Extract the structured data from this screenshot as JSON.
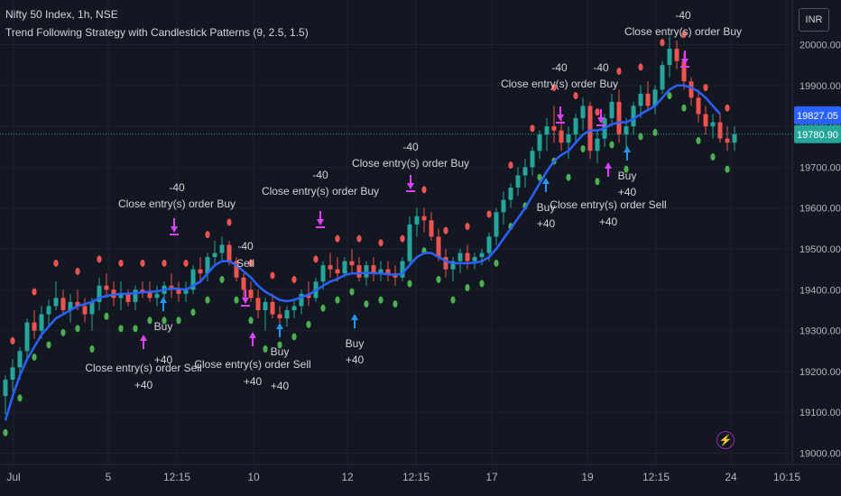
{
  "header": {
    "symbol": "Nifty 50 Index, 1h, NSE",
    "study": "Trend Following Strategy with Candlestick Patterns (9, 2.5, 1.5)"
  },
  "currency_button": "INR",
  "colors": {
    "background": "#131722",
    "up": "#26a69a",
    "down": "#ef5350",
    "ema": "#2962ff",
    "signal": "#e040fb",
    "stop_dot": "#4caf50",
    "dot_red": "#ef5350",
    "arrow": "#2196f3"
  },
  "chart_data": {
    "type": "candlestick",
    "title": "",
    "ylim": [
      19000,
      20050
    ],
    "y_ticks": [
      "20000.00",
      "19900.00",
      "19800.00",
      "19700.00",
      "19600.00",
      "19500.00",
      "19400.00",
      "19300.00",
      "19200.00",
      "19100.00",
      "19000.00"
    ],
    "x_ticks": [
      "Jul",
      "5",
      "12:15",
      "10",
      "12",
      "12:15",
      "17",
      "19",
      "12:15",
      "24",
      "10:15"
    ],
    "price_labels": [
      {
        "value": 19827.05,
        "text": "19827.05",
        "color": "#2962ff"
      },
      {
        "value": 19780.9,
        "text": "19780.90",
        "color": "#26a69a"
      }
    ],
    "candles": [
      [
        19140,
        19190,
        19095,
        19180
      ],
      [
        19180,
        19230,
        19150,
        19210
      ],
      [
        19210,
        19260,
        19180,
        19250
      ],
      [
        19250,
        19330,
        19230,
        19320
      ],
      [
        19320,
        19350,
        19280,
        19300
      ],
      [
        19300,
        19360,
        19280,
        19340
      ],
      [
        19340,
        19375,
        19310,
        19360
      ],
      [
        19360,
        19420,
        19350,
        19380
      ],
      [
        19380,
        19400,
        19340,
        19350
      ],
      [
        19350,
        19390,
        19320,
        19370
      ],
      [
        19370,
        19400,
        19350,
        19360
      ],
      [
        19360,
        19380,
        19320,
        19340
      ],
      [
        19340,
        19380,
        19300,
        19370
      ],
      [
        19370,
        19430,
        19350,
        19410
      ],
      [
        19410,
        19440,
        19380,
        19400
      ],
      [
        19400,
        19420,
        19360,
        19380
      ],
      [
        19380,
        19420,
        19350,
        19390
      ],
      [
        19390,
        19400,
        19360,
        19370
      ],
      [
        19370,
        19410,
        19350,
        19400
      ],
      [
        19400,
        19420,
        19380,
        19395
      ],
      [
        19395,
        19420,
        19370,
        19380
      ],
      [
        19380,
        19410,
        19360,
        19390
      ],
      [
        19390,
        19420,
        19370,
        19410
      ],
      [
        19410,
        19440,
        19380,
        19400
      ],
      [
        19400,
        19420,
        19370,
        19390
      ],
      [
        19390,
        19420,
        19370,
        19400
      ],
      [
        19400,
        19460,
        19390,
        19450
      ],
      [
        19450,
        19480,
        19420,
        19440
      ],
      [
        19440,
        19490,
        19420,
        19480
      ],
      [
        19480,
        19520,
        19460,
        19490
      ],
      [
        19490,
        19530,
        19470,
        19510
      ],
      [
        19510,
        19520,
        19460,
        19470
      ],
      [
        19470,
        19480,
        19420,
        19430
      ],
      [
        19430,
        19440,
        19380,
        19400
      ],
      [
        19400,
        19420,
        19370,
        19380
      ],
      [
        19380,
        19400,
        19330,
        19350
      ],
      [
        19350,
        19380,
        19300,
        19370
      ],
      [
        19370,
        19390,
        19330,
        19340
      ],
      [
        19340,
        19360,
        19310,
        19330
      ],
      [
        19330,
        19360,
        19310,
        19350
      ],
      [
        19350,
        19380,
        19330,
        19360
      ],
      [
        19360,
        19400,
        19340,
        19390
      ],
      [
        19390,
        19420,
        19360,
        19380
      ],
      [
        19380,
        19430,
        19370,
        19420
      ],
      [
        19420,
        19470,
        19400,
        19460
      ],
      [
        19460,
        19490,
        19430,
        19450
      ],
      [
        19450,
        19480,
        19420,
        19440
      ],
      [
        19440,
        19480,
        19430,
        19470
      ],
      [
        19470,
        19500,
        19440,
        19460
      ],
      [
        19460,
        19480,
        19420,
        19430
      ],
      [
        19430,
        19470,
        19410,
        19460
      ],
      [
        19460,
        19480,
        19420,
        19440
      ],
      [
        19440,
        19470,
        19420,
        19450
      ],
      [
        19450,
        19470,
        19420,
        19440
      ],
      [
        19440,
        19460,
        19410,
        19430
      ],
      [
        19430,
        19480,
        19420,
        19470
      ],
      [
        19470,
        19580,
        19460,
        19560
      ],
      [
        19560,
        19600,
        19530,
        19580
      ],
      [
        19580,
        19600,
        19540,
        19570
      ],
      [
        19570,
        19590,
        19520,
        19530
      ],
      [
        19530,
        19550,
        19470,
        19480
      ],
      [
        19480,
        19500,
        19430,
        19450
      ],
      [
        19450,
        19480,
        19420,
        19470
      ],
      [
        19470,
        19500,
        19440,
        19490
      ],
      [
        19490,
        19510,
        19450,
        19470
      ],
      [
        19470,
        19490,
        19450,
        19480
      ],
      [
        19480,
        19500,
        19460,
        19490
      ],
      [
        19490,
        19540,
        19470,
        19530
      ],
      [
        19530,
        19600,
        19510,
        19590
      ],
      [
        19590,
        19640,
        19560,
        19620
      ],
      [
        19620,
        19660,
        19600,
        19650
      ],
      [
        19650,
        19700,
        19630,
        19680
      ],
      [
        19680,
        19720,
        19650,
        19700
      ],
      [
        19700,
        19750,
        19680,
        19740
      ],
      [
        19740,
        19790,
        19720,
        19780
      ],
      [
        19780,
        19820,
        19740,
        19800
      ],
      [
        19800,
        19850,
        19760,
        19790
      ],
      [
        19790,
        19830,
        19740,
        19760
      ],
      [
        19760,
        19800,
        19720,
        19780
      ],
      [
        19780,
        19830,
        19760,
        19820
      ],
      [
        19820,
        19870,
        19790,
        19850
      ],
      [
        19850,
        19860,
        19720,
        19740
      ],
      [
        19740,
        19790,
        19710,
        19770
      ],
      [
        19770,
        19830,
        19750,
        19820
      ],
      [
        19820,
        19880,
        19800,
        19860
      ],
      [
        19860,
        19890,
        19760,
        19780
      ],
      [
        19780,
        19820,
        19740,
        19800
      ],
      [
        19800,
        19860,
        19780,
        19850
      ],
      [
        19850,
        19900,
        19820,
        19880
      ],
      [
        19880,
        19910,
        19840,
        19850
      ],
      [
        19850,
        19900,
        19830,
        19890
      ],
      [
        19890,
        19960,
        19880,
        19950
      ],
      [
        19950,
        20020,
        19920,
        19990
      ],
      [
        19990,
        20010,
        19940,
        19960
      ],
      [
        19960,
        19980,
        19890,
        19910
      ],
      [
        19910,
        19920,
        19850,
        19870
      ],
      [
        19870,
        19890,
        19810,
        19830
      ],
      [
        19830,
        19850,
        19780,
        19800
      ],
      [
        19800,
        19830,
        19770,
        19810
      ],
      [
        19810,
        19830,
        19760,
        19770
      ],
      [
        19770,
        19800,
        19740,
        19760
      ],
      [
        19760,
        19800,
        19740,
        19781
      ]
    ],
    "ema": [
      19080,
      19140,
      19190,
      19230,
      19260,
      19290,
      19310,
      19330,
      19340,
      19350,
      19360,
      19365,
      19370,
      19380,
      19385,
      19388,
      19390,
      19390,
      19392,
      19394,
      19395,
      19396,
      19400,
      19403,
      19402,
      19400,
      19410,
      19420,
      19440,
      19460,
      19470,
      19470,
      19460,
      19445,
      19430,
      19410,
      19395,
      19385,
      19375,
      19372,
      19375,
      19382,
      19388,
      19398,
      19410,
      19420,
      19426,
      19436,
      19440,
      19440,
      19442,
      19440,
      19440,
      19438,
      19436,
      19440,
      19460,
      19480,
      19490,
      19490,
      19480,
      19470,
      19465,
      19465,
      19465,
      19466,
      19470,
      19480,
      19500,
      19525,
      19550,
      19575,
      19600,
      19630,
      19660,
      19690,
      19715,
      19730,
      19740,
      19760,
      19780,
      19790,
      19790,
      19795,
      19805,
      19810,
      19810,
      19818,
      19830,
      19840,
      19850,
      19870,
      19890,
      19900,
      19900,
      19895,
      19885,
      19870,
      19850,
      19830
    ],
    "annotations": [
      "-40",
      "Close entry(s) order Buy",
      "Close entry(s) order Sell",
      "Buy",
      "Sell",
      "+40"
    ]
  }
}
